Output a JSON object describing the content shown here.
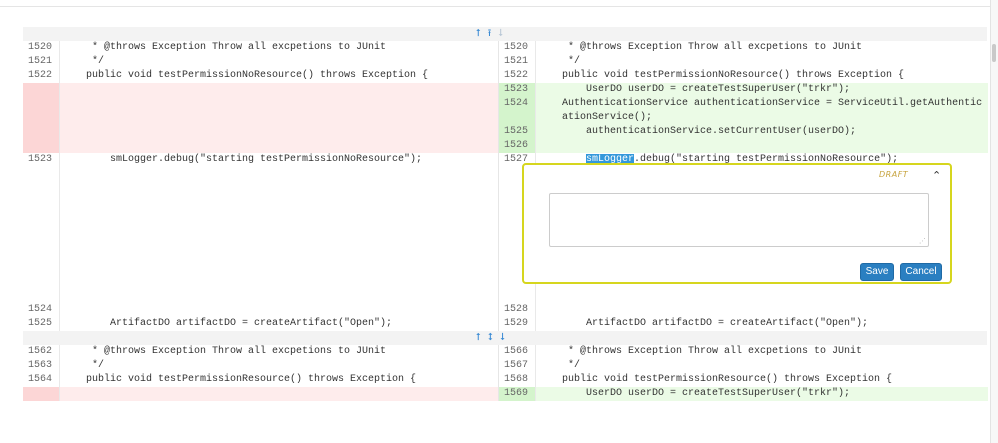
{
  "expanders": [
    {
      "arrows": [
        {
          "glyph": "⭡",
          "dim": false
        },
        {
          "glyph": "⭱",
          "dim": false
        },
        {
          "glyph": "⭣",
          "dim": true
        }
      ]
    },
    {
      "arrows": [
        {
          "glyph": "⭡",
          "dim": false
        },
        {
          "glyph": "⭥",
          "dim": false
        },
        {
          "glyph": "⭣",
          "dim": false
        }
      ]
    }
  ],
  "hunk1": [
    {
      "type": "ctx",
      "lnum": "1520",
      "rnum": "1520",
      "ltext": " * @throws Exception Throw all excpetions to JUnit",
      "rtext": " * @throws Exception Throw all excpetions to JUnit"
    },
    {
      "type": "ctx",
      "lnum": "1521",
      "rnum": "1521",
      "ltext": " */",
      "rtext": " */"
    },
    {
      "type": "ctx",
      "lnum": "1522",
      "rnum": "1522",
      "ltext": "public void testPermissionNoResource() throws Exception {",
      "rtext": "public void testPermissionNoResource() throws Exception {"
    },
    {
      "type": "add",
      "lnum": "",
      "rnum": "1523",
      "ltext": "",
      "rtext": "    UserDO userDO = createTestSuperUser(\"trkr\");"
    },
    {
      "type": "add",
      "lnum": "",
      "rnum": "1524",
      "ltext": "",
      "rtext": "    AuthenticationService authenticationService = ServiceUtil.getAuthenticationService();",
      "wrap": true
    },
    {
      "type": "add",
      "lnum": "",
      "rnum": "1525",
      "ltext": "",
      "rtext": "    authenticationService.setCurrentUser(userDO);"
    },
    {
      "type": "add",
      "lnum": "",
      "rnum": "1526",
      "ltext": "",
      "rtext": ""
    }
  ],
  "logger_row": {
    "lnum": "1523",
    "rnum": "1527",
    "ltext": "    smLogger.debug(\"starting testPermissionNoResource\");",
    "rtext_pre": "    ",
    "rtext_hl": "smLogger",
    "rtext_post": ".debug(\"starting testPermissionNoResource\");"
  },
  "hunk1_tail": [
    {
      "type": "ctx",
      "lnum": "1524",
      "rnum": "1528",
      "ltext": "",
      "rtext": ""
    },
    {
      "type": "ctx",
      "lnum": "1525",
      "rnum": "1529",
      "ltext": "    ArtifactDO artifactDO = createArtifact(\"Open\");",
      "rtext": "    ArtifactDO artifactDO = createArtifact(\"Open\");"
    }
  ],
  "hunk2": [
    {
      "type": "ctx",
      "lnum": "1562",
      "rnum": "1566",
      "ltext": " * @throws Exception Throw all excpetions to JUnit",
      "rtext": " * @throws Exception Throw all excpetions to JUnit"
    },
    {
      "type": "ctx",
      "lnum": "1563",
      "rnum": "1567",
      "ltext": " */",
      "rtext": " */"
    },
    {
      "type": "ctx",
      "lnum": "1564",
      "rnum": "1568",
      "ltext": "public void testPermissionResource() throws Exception {",
      "rtext": "public void testPermissionResource() throws Exception {"
    },
    {
      "type": "add",
      "lnum": "",
      "rnum": "1569",
      "ltext": "",
      "rtext": "    UserDO userDO = createTestSuperUser(\"trkr\");"
    }
  ],
  "comment": {
    "status": "DRAFT",
    "collapse_glyph": "⌃",
    "textarea_value": "",
    "resize_glyph": "⋰",
    "save_label": "Save",
    "cancel_label": "Cancel"
  }
}
